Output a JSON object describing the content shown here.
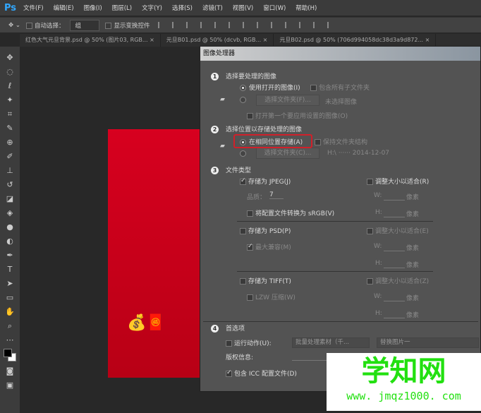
{
  "app": {
    "logo": "Ps"
  },
  "menu": [
    "文件(F)",
    "编辑(E)",
    "图像(I)",
    "图层(L)",
    "文字(Y)",
    "选择(S)",
    "滤镜(T)",
    "视图(V)",
    "窗口(W)",
    "帮助(H)"
  ],
  "options": {
    "auto_select": "自动选择：",
    "group": "组",
    "show_transform": "显示变换控件"
  },
  "tabs": [
    "红色大气元旦背景.psd @ 50% (图片03, RGB... ×",
    "元旦B01.psd @ 50% (dcvb, RGB... ×",
    "元旦B02.psd @ 50% (706d994058dc38d3a9d872... ×"
  ],
  "dialog": {
    "title": "图像处理器",
    "s1": {
      "num": "1",
      "title": "选择要处理的图像",
      "use_open": "使用打开的图像(I)",
      "include_sub": "包含所有子文件夹",
      "select_folder": "选择文件夹(F)...",
      "no_image": "未选择图像",
      "open_first": "打开第一个要应用设置的图像(O)"
    },
    "s2": {
      "num": "2",
      "title": "选择位置以存储处理的图像",
      "same_location": "在相同位置存储(A)",
      "keep_structure": "保持文件夹结构",
      "select_folder": "选择文件夹(C)...",
      "path": "H:\\ ······ 2014-12-07"
    },
    "s3": {
      "num": "3",
      "title": "文件类型",
      "jpeg": "存储为 JPEG(J)",
      "resize_r": "调整大小以适合(R)",
      "quality_label": "品质：",
      "quality": "7",
      "srgb": "将配置文件转换为 sRGB(V)",
      "psd": "存储为 PSD(P)",
      "resize_e": "调整大小以适合(E)",
      "maximize": "最大兼容(M)",
      "tiff": "存储为 TIFF(T)",
      "resize_z": "调整大小以适合(Z)",
      "lzw": "LZW 压缩(W)",
      "w": "W:",
      "h": "H:",
      "px": "像素"
    },
    "s4": {
      "num": "4",
      "title": "首选项",
      "run_action": "运行动作(U):",
      "action_set": "批量处理素材（千...",
      "action": "替换图片一",
      "copyright": "版权信息:",
      "icc": "包含 ICC 配置文件(D)"
    }
  },
  "watermark": {
    "title": "学知网",
    "url": "www. jmqz1000. com"
  }
}
